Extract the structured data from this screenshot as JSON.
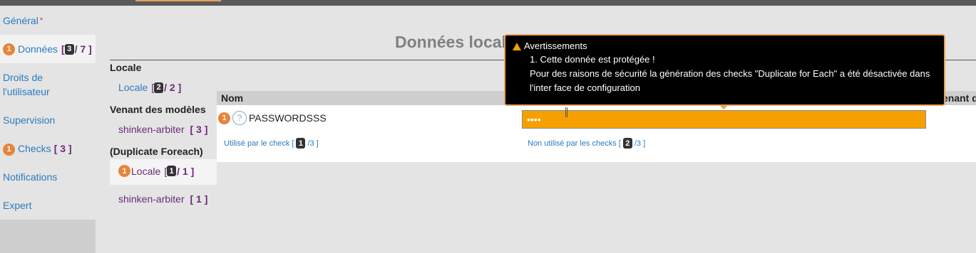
{
  "nav": {
    "general": "Général",
    "required_mark": "*",
    "donnees_badge": "1",
    "donnees_label": "Données",
    "donnees_open": "[",
    "donnees_count": "3",
    "donnees_total": "/ 7 ]",
    "droits_line1": "Droits de",
    "droits_line2": "l'utilisateur",
    "supervision": "Supervision",
    "checks_badge": "1",
    "checks_label": "Checks",
    "checks_count": "[ 3 ]",
    "notifications": "Notifications",
    "expert": "Expert"
  },
  "sub": {
    "locale_heading": "Locale",
    "locale_link": "Locale",
    "locale_open": "[",
    "locale_count": "2",
    "locale_total": "/ 2 ]",
    "models_heading": "Venant des modèles",
    "models_link": "shinken-arbiter",
    "models_count": "[ 3 ]",
    "dup_heading": "(Duplicate Foreach)",
    "dup_badge": "1",
    "dup_link": "Locale",
    "dup_open": "[",
    "dup_count": "1",
    "dup_total": "/ 1 ]",
    "dup_models_link": "shinken-arbiter",
    "dup_models_count": "[ 1 ]"
  },
  "main": {
    "title": "Données locale",
    "col_nom": "Nom",
    "col_right": "enant des",
    "row_badge": "1",
    "row_help": "?",
    "row_name": "PASSWORDSSS",
    "password_value": "••••",
    "used_label": "Utilisé par le check [",
    "used_count": "1",
    "used_total": "/3 ]",
    "notused_label": "Non utilisé par les checks [",
    "notused_count": "2",
    "notused_total": "/3 ]"
  },
  "tooltip": {
    "title": "Avertissements",
    "item": "1. Cette donnée est protégée !",
    "body": "Pour des raisons de sécurité la génération des checks \"Duplicate for Each\" a été désactivée dans l'inter face de configuration"
  },
  "colors": {
    "accent_orange": "#f5a000",
    "badge_orange": "#e8833a",
    "link_blue": "#2a7bbf",
    "count_purple": "#6b2a7a"
  }
}
